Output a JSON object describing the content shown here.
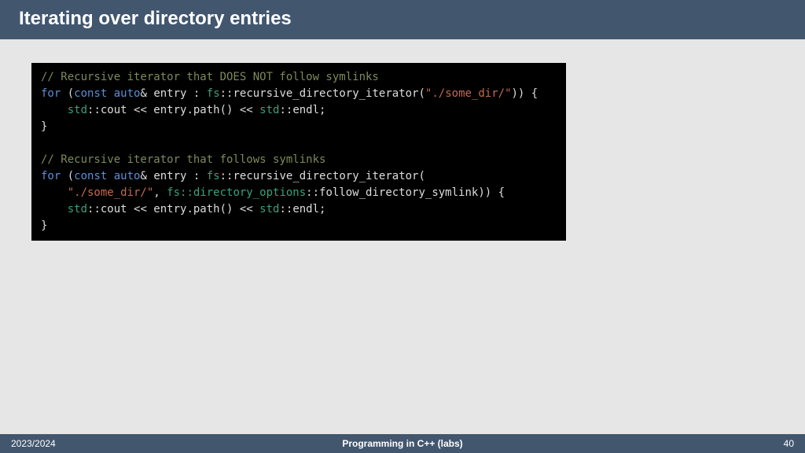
{
  "header": {
    "title": "Iterating over directory entries"
  },
  "code": {
    "l1_comment": "// Recursive iterator that DOES NOT follow symlinks",
    "l2_for": "for",
    "l2_const": "const",
    "l2_auto": "auto",
    "l2_amp_entry_colon": "& entry : ",
    "l2_fs": "fs",
    "l2_rdi": "::recursive_directory_iterator(",
    "l2_str": "\"./some_dir/\"",
    "l2_end": ")) {",
    "l3_std": "std",
    "l3_cout": "::cout << entry.path() << ",
    "l3_std2": "std",
    "l3_endl": "::endl;",
    "l4_close": "}",
    "l6_comment": "// Recursive iterator that follows symlinks",
    "l7_for": "for",
    "l7_const": "const",
    "l7_auto": "auto",
    "l7_amp_entry_colon": "& entry : ",
    "l7_fs": "fs",
    "l7_rdi": "::recursive_directory_iterator(",
    "l8_str": "\"./some_dir/\"",
    "l8_comma": ", ",
    "l8_fs": "fs",
    "l8_diropt": "::directory_options",
    "l8_follow": "::follow_directory_symlink)) {",
    "l9_std": "std",
    "l9_cout": "::cout << entry.path() << ",
    "l9_std2": "std",
    "l9_endl": "::endl;",
    "l10_close": "}"
  },
  "footer": {
    "left": "2023/2024",
    "center": "Programming in C++ (labs)",
    "right": "40"
  }
}
